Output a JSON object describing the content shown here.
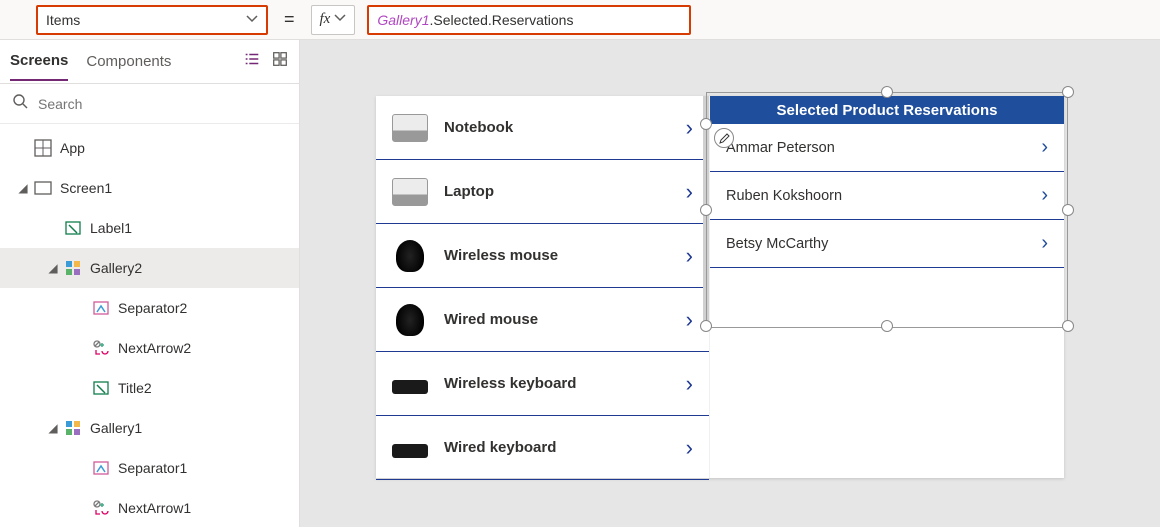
{
  "property": {
    "name": "Items"
  },
  "formula": {
    "ref": "Gallery1",
    "path": ".Selected.Reservations"
  },
  "panel": {
    "tabs": {
      "screens": "Screens",
      "components": "Components"
    },
    "search_placeholder": "Search"
  },
  "tree": {
    "app": "App",
    "screen1": "Screen1",
    "label1": "Label1",
    "gallery2": "Gallery2",
    "separator2": "Separator2",
    "nextarrow2": "NextArrow2",
    "title2": "Title2",
    "gallery1": "Gallery1",
    "separator1": "Separator1",
    "nextarrow1": "NextArrow1"
  },
  "gallery1": {
    "items": [
      {
        "label": "Notebook"
      },
      {
        "label": "Laptop"
      },
      {
        "label": "Wireless mouse"
      },
      {
        "label": "Wired mouse"
      },
      {
        "label": "Wireless keyboard"
      },
      {
        "label": "Wired keyboard"
      }
    ]
  },
  "gallery2": {
    "header": "Selected Product Reservations",
    "items": [
      {
        "label": "Ammar Peterson"
      },
      {
        "label": "Ruben Kokshoorn"
      },
      {
        "label": "Betsy McCarthy"
      }
    ]
  }
}
